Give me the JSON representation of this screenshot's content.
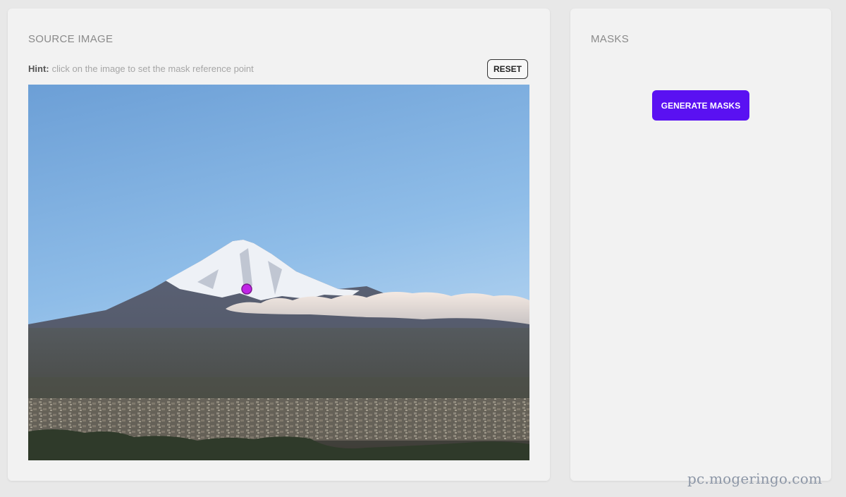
{
  "source_panel": {
    "title": "SOURCE IMAGE",
    "hint_label": "Hint:",
    "hint_text": "click on the image to set the mask reference point",
    "reset_label": "RESET",
    "image_subject": "mount-fuji-landscape-photo",
    "marker_color": "#c024e6"
  },
  "masks_panel": {
    "title": "MASKS",
    "generate_label": "GENERATE MASKS",
    "accent_color": "#5a11f2"
  },
  "watermark": "pc.mogeringo.com"
}
